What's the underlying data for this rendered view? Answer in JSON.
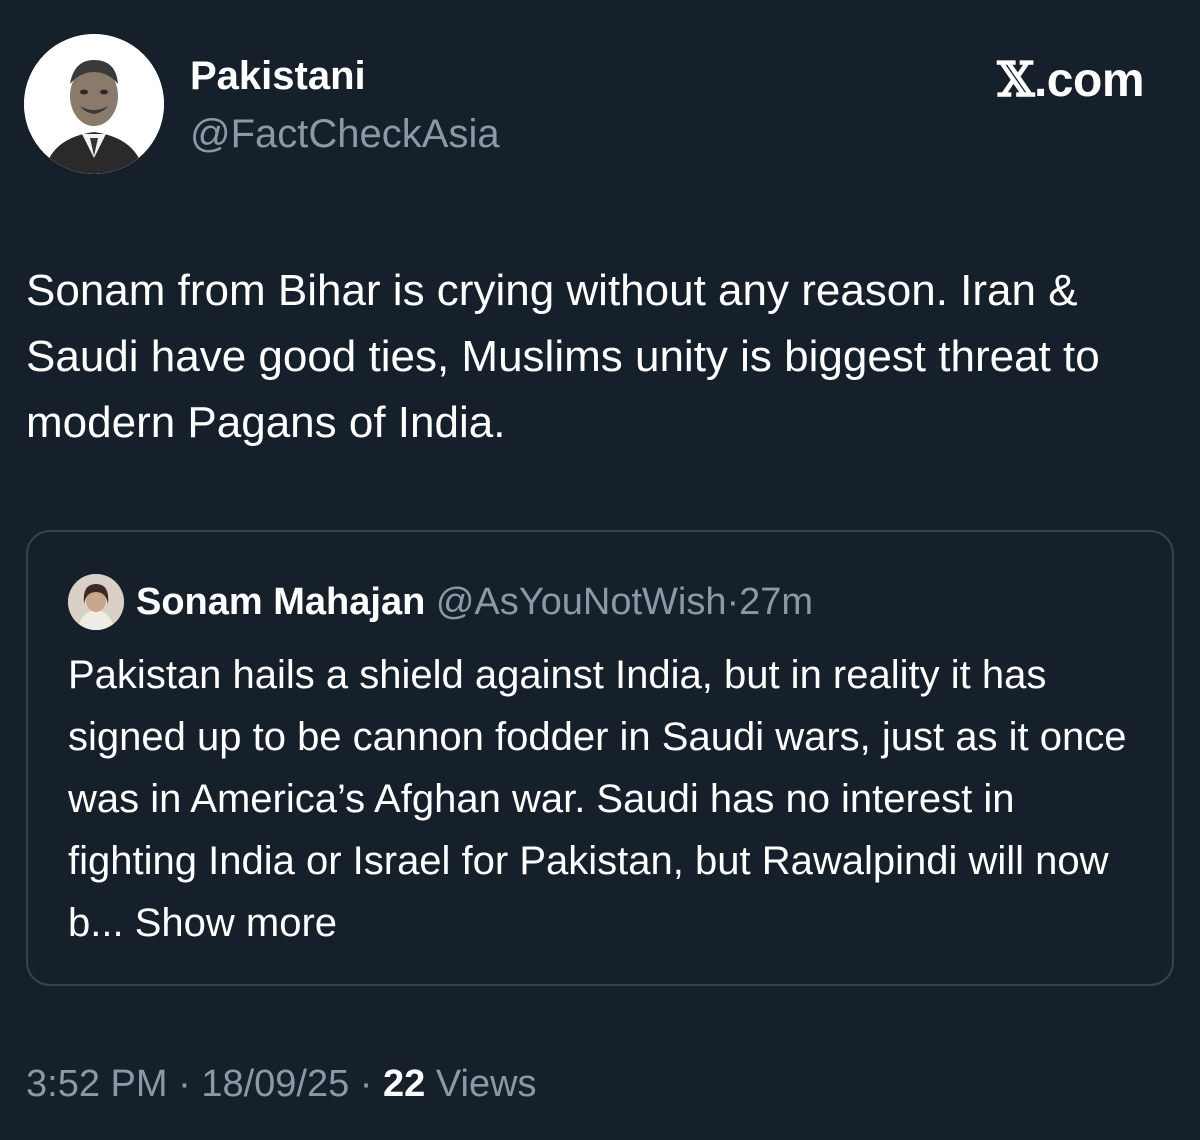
{
  "author": {
    "display_name": "Pakistani",
    "handle": "@FactCheckAsia",
    "avatar_icon": "portrait-avatar"
  },
  "brand": {
    "mark": "𝕏",
    "suffix": ".com"
  },
  "post": {
    "text": "Sonam from Bihar is crying without any reason. Iran & Saudi have good ties, Muslims unity is biggest threat to modern Pagans of India."
  },
  "quoted_post": {
    "display_name": "Sonam Mahajan",
    "handle": "@AsYouNotWish",
    "separator": "·",
    "time": "27m",
    "text": "Pakistan hails a shield against India, but in reality it has signed up to be cannon fodder in Saudi wars, just as it once was in America’s Afghan war. Saudi has no interest in fighting India or Israel for Pakistan, but Rawalpindi will now b...",
    "show_more": "Show more"
  },
  "meta": {
    "time": "3:52 PM",
    "sep1": "·",
    "date": "18/09/25",
    "sep2": "·",
    "views_count": "22",
    "views_label": "Views"
  },
  "colors": {
    "background": "#15202b",
    "primary_text": "#ffffff",
    "secondary_text": "#8b98a5",
    "border": "#38444d"
  }
}
